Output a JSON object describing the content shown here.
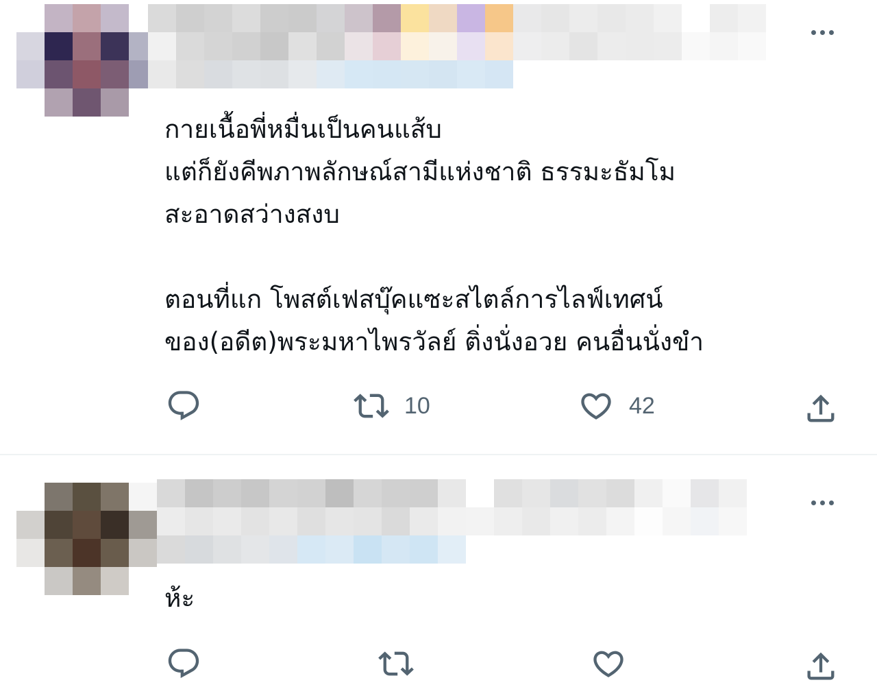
{
  "tweets": [
    {
      "body": "กายเนื้อพี่หมื่นเป็นคนแส้บ\nแต่ก็ยังคีพภาพลักษณ์สามีแห่งชาติ ธรรมะธัมโม\nสะอาดสว่างสงบ\n\nตอนที่แก โพสต์เฟสบุ๊คแซะสไตล์การไลฟ์เทศน์\nของ(อดีต)พระมหาไพรวัลย์ ติ่งนั่งอวย คนอื่นนั่งขำ",
      "actions": {
        "reply": "",
        "retweet": "10",
        "like": "42"
      }
    },
    {
      "body": "ห้ะ",
      "actions": {
        "reply": "",
        "retweet": "",
        "like": ""
      }
    }
  ],
  "icons": {
    "reply": "reply-icon",
    "retweet": "retweet-icon",
    "like": "heart-icon",
    "share": "share-icon",
    "more": "more-options-icon"
  },
  "colors": {
    "text": "#0f1419",
    "secondary": "#536471",
    "divider": "#eff3f4"
  }
}
